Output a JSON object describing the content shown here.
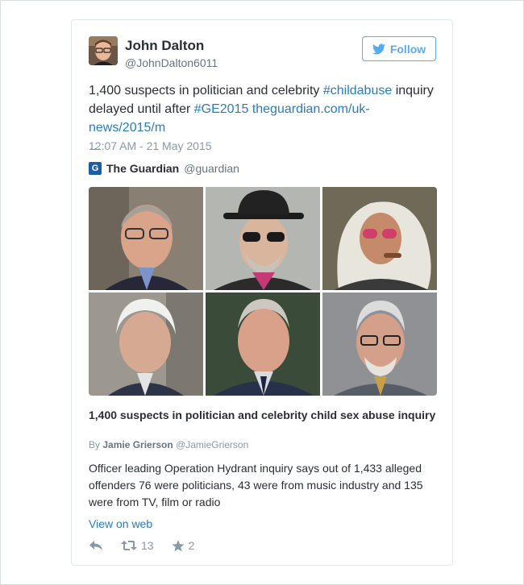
{
  "author": {
    "name": "John Dalton",
    "handle": "@JohnDalton6011"
  },
  "follow_label": "Follow",
  "tweet": {
    "text_1": "1,400 suspects in politician and celebrity ",
    "hashtag_1": "#childabuse",
    "text_2": " inquiry delayed until after ",
    "hashtag_2": "#GE2015",
    "link": "theguardian.com/uk-news/2015/m",
    "ellipsis": "…",
    "timestamp": "12:07 AM - 21 May 2015"
  },
  "source": {
    "logo": "G",
    "name": "The Guardian",
    "handle": "@guardian"
  },
  "card": {
    "headline": "1,400 suspects in politician and celebrity child sex abuse inquiry",
    "byline_prefix": "By ",
    "byline_author": "Jamie Grierson",
    "byline_handle": "@JamieGrierson",
    "summary": "Officer leading Operation Hydrant inquiry says out of 1,433 alleged offenders 76 were politicians, 43 were from music industry and 135 were from TV, film or radio"
  },
  "view_on_web": "View on web",
  "actions": {
    "retweet_count": "13",
    "favorite_count": "2"
  },
  "colors": {
    "accent": "#55acee",
    "link": "#2b7bb9",
    "muted": "#8899a6"
  }
}
